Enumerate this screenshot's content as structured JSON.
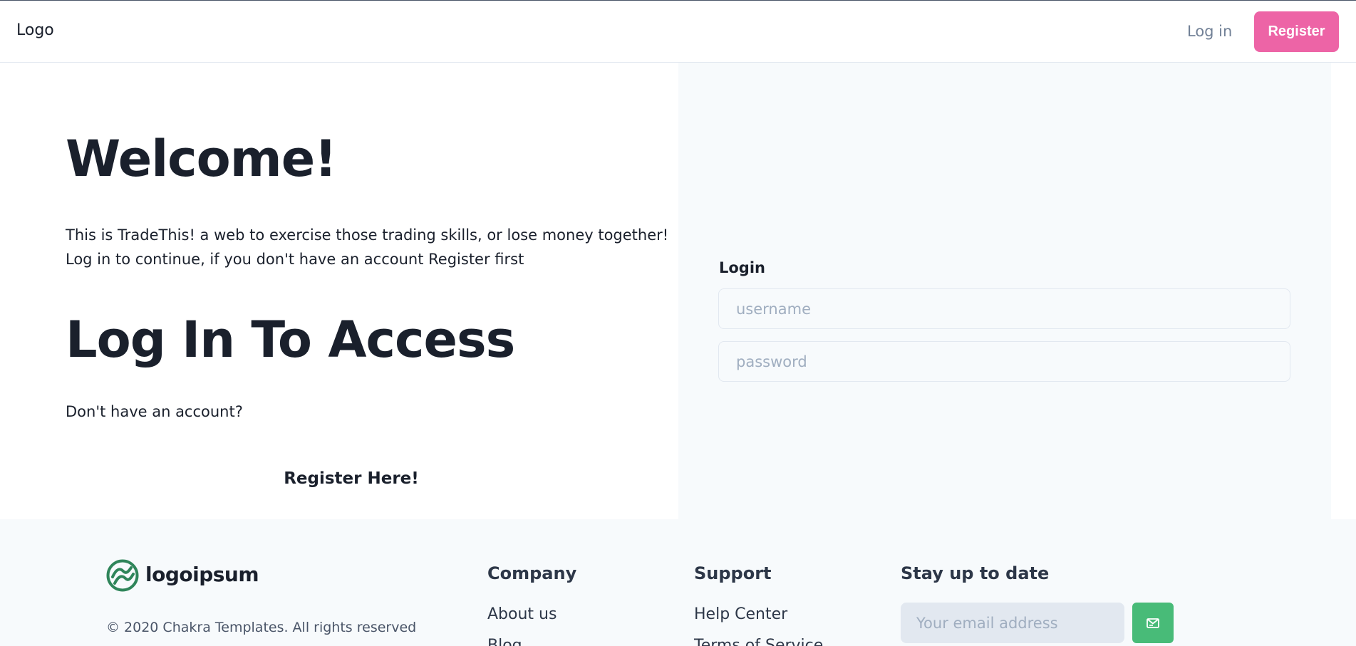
{
  "header": {
    "logo": "Logo",
    "login_link": "Log in",
    "register_button": "Register"
  },
  "hero": {
    "title": "Welcome!",
    "intro_line1": "This is TradeThis! a web to exercise those trading skills, or lose money together!",
    "intro_line2": "Log in to continue, if you don't have an account Register first",
    "login_heading": "Log In To Access",
    "no_account": "Don't have an account?",
    "register_here": "Register Here!"
  },
  "login_form": {
    "label": "Login",
    "username_placeholder": "username",
    "password_placeholder": "password"
  },
  "footer": {
    "brand": "logoipsum",
    "copyright": "© 2020 Chakra Templates. All rights reserved",
    "company": {
      "title": "Company",
      "links": [
        "About us",
        "Blog"
      ]
    },
    "support": {
      "title": "Support",
      "links": [
        "Help Center",
        "Terms of Service"
      ]
    },
    "newsletter": {
      "title": "Stay up to date",
      "email_placeholder": "Your email address",
      "icon": "mail-icon"
    }
  },
  "colors": {
    "register_pink": "#ed64a6",
    "subscribe_green": "#48bb78",
    "brand_green": "#2f855a",
    "panel_bg": "#f7fafc"
  }
}
